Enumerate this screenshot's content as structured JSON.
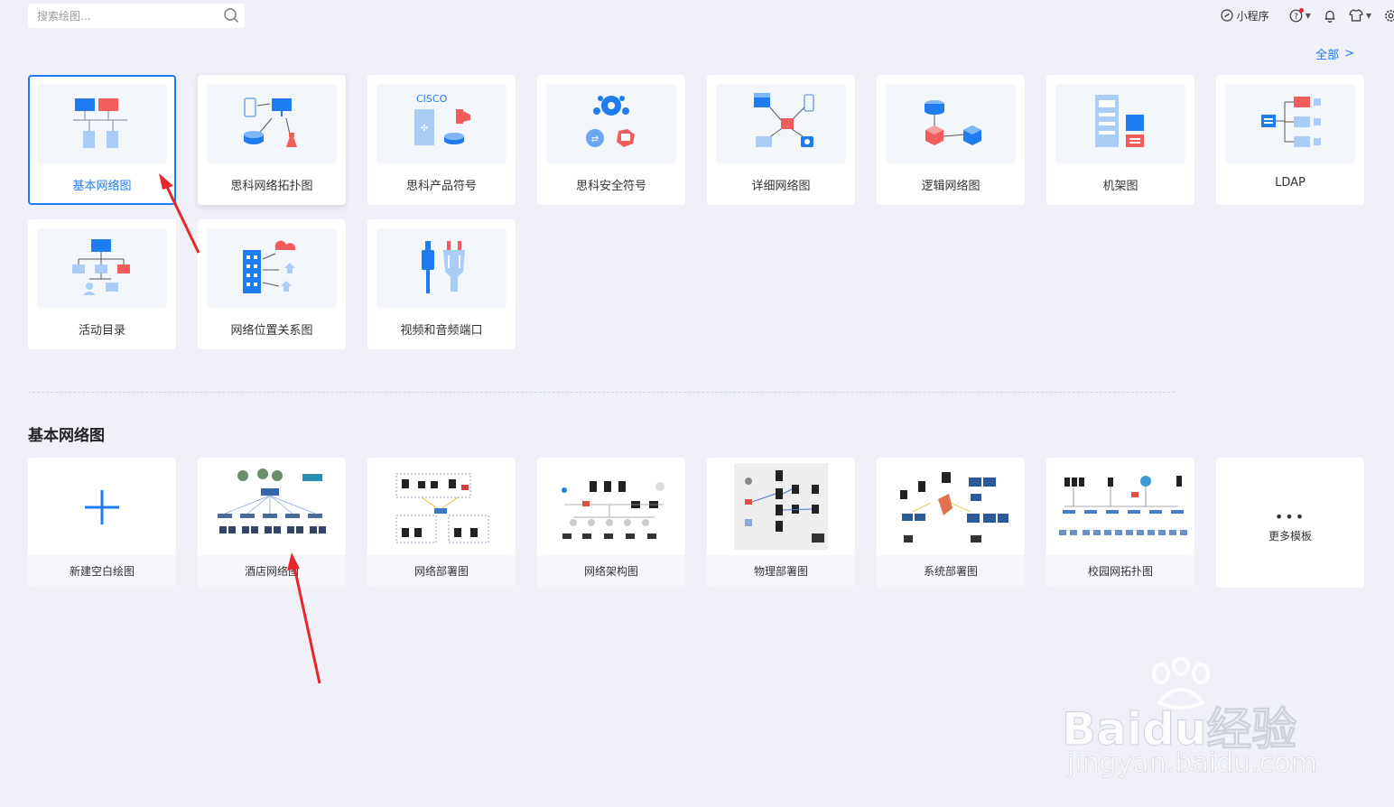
{
  "search": {
    "placeholder": "搜索绘图..."
  },
  "topbar": {
    "mini_program": "小程序"
  },
  "all_link": {
    "label": "全部",
    "chevron": ">"
  },
  "categories": [
    {
      "label": "基本网络图",
      "icon": "basic-network-icon",
      "selected": true
    },
    {
      "label": "思科网络拓扑图",
      "icon": "cisco-topology-icon"
    },
    {
      "label": "思科产品符号",
      "icon": "cisco-product-icon",
      "brand": "CISCO"
    },
    {
      "label": "思科安全符号",
      "icon": "cisco-security-icon"
    },
    {
      "label": "详细网络图",
      "icon": "detailed-network-icon"
    },
    {
      "label": "逻辑网络图",
      "icon": "logical-network-icon"
    },
    {
      "label": "机架图",
      "icon": "rack-icon"
    },
    {
      "label": "LDAP",
      "icon": "ldap-icon"
    },
    {
      "label": "活动目录",
      "icon": "active-directory-icon"
    },
    {
      "label": "网络位置关系图",
      "icon": "network-location-icon"
    },
    {
      "label": "视频和音频端口",
      "icon": "av-port-icon"
    }
  ],
  "section": {
    "title": "基本网络图"
  },
  "templates": [
    {
      "label": "新建空白绘图",
      "icon": "plus-icon"
    },
    {
      "label": "酒店网络图"
    },
    {
      "label": "网络部署图"
    },
    {
      "label": "网络架构图"
    },
    {
      "label": "物理部署图"
    },
    {
      "label": "系统部署图"
    },
    {
      "label": "校园网拓扑图"
    }
  ],
  "more": {
    "dots": "•••",
    "label": "更多模板"
  },
  "watermark": {
    "text": "Baidu经验",
    "url": "jingyan.baidu.com"
  },
  "colors": {
    "accent": "#1f7cf0",
    "red": "#f25c5c",
    "light_blue": "#a9cdf7",
    "arrow": "#e8262a"
  }
}
